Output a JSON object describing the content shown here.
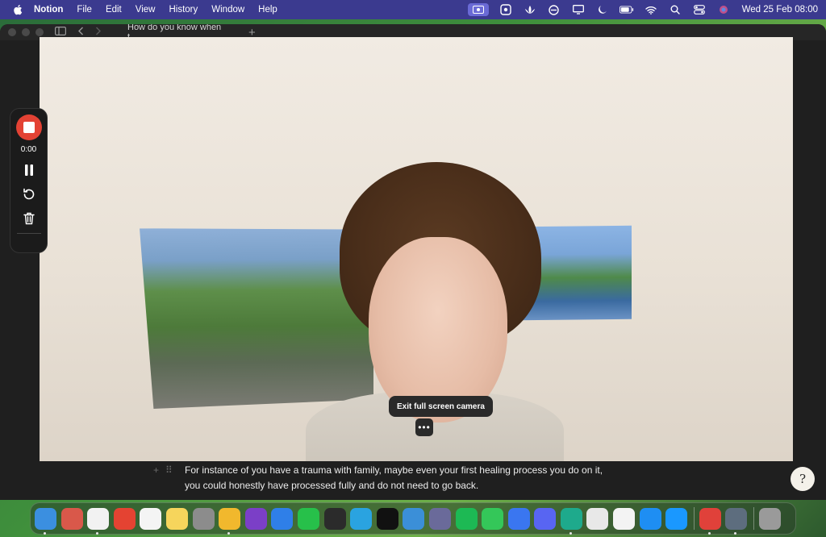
{
  "menubar": {
    "app_name": "Notion",
    "menus": [
      "File",
      "Edit",
      "View",
      "History",
      "Window",
      "Help"
    ],
    "clock": "Wed 25 Feb  08:00"
  },
  "window": {
    "tab_title": "How do you know when t..."
  },
  "recorder": {
    "timer": "0:00"
  },
  "camera": {
    "tooltip": "Exit full screen camera",
    "more_label": "•••"
  },
  "editor": {
    "line1": "For instance of you have a trauma with family, maybe even your first healing process you do on it,",
    "line2": "you could honestly have processed fully and do not need to go back.",
    "help_label": "?"
  },
  "dock": {
    "apps": [
      {
        "name": "finder",
        "color": "#3b8fe0",
        "running": true
      },
      {
        "name": "launchpad",
        "color": "#d9584a",
        "running": false
      },
      {
        "name": "notion",
        "color": "#f2f2f2",
        "running": true
      },
      {
        "name": "todoist",
        "color": "#e44332",
        "running": false
      },
      {
        "name": "reminders",
        "color": "#f4f4f4",
        "running": false
      },
      {
        "name": "notes",
        "color": "#f6d55c",
        "running": false
      },
      {
        "name": "system-settings",
        "color": "#8c8c8c",
        "running": false
      },
      {
        "name": "chrome",
        "color": "#f1b82d",
        "running": true
      },
      {
        "name": "tor-browser",
        "color": "#7b3fc7",
        "running": false
      },
      {
        "name": "safari-helper",
        "color": "#2f7fe8",
        "running": false
      },
      {
        "name": "whatsapp",
        "color": "#27c04a",
        "running": false
      },
      {
        "name": "voice-memos",
        "color": "#2b2b2b",
        "running": false
      },
      {
        "name": "telegram",
        "color": "#2aa3e0",
        "running": false
      },
      {
        "name": "capcut",
        "color": "#111111",
        "running": false
      },
      {
        "name": "canva",
        "color": "#3b8fd8",
        "running": false
      },
      {
        "name": "opal",
        "color": "#6a6a9a",
        "running": false
      },
      {
        "name": "spotify",
        "color": "#1db954",
        "running": false
      },
      {
        "name": "messages",
        "color": "#34c759",
        "running": false
      },
      {
        "name": "signal",
        "color": "#3a76f0",
        "running": false
      },
      {
        "name": "discord",
        "color": "#5865f2",
        "running": false
      },
      {
        "name": "surfshark",
        "color": "#1eaa8c",
        "running": true
      },
      {
        "name": "calm",
        "color": "#e8e8e8",
        "running": false
      },
      {
        "name": "photos",
        "color": "#f3f3f3",
        "running": false
      },
      {
        "name": "app-store",
        "color": "#1e8ef3",
        "running": false
      },
      {
        "name": "prime-video",
        "color": "#1a98ff",
        "running": false
      },
      {
        "name": "pdf-expert",
        "color": "#e0413a",
        "running": true
      },
      {
        "name": "quicktime",
        "color": "#5d6d7e",
        "running": true
      },
      {
        "name": "trash",
        "color": "#9a9a9a",
        "running": false
      }
    ]
  }
}
